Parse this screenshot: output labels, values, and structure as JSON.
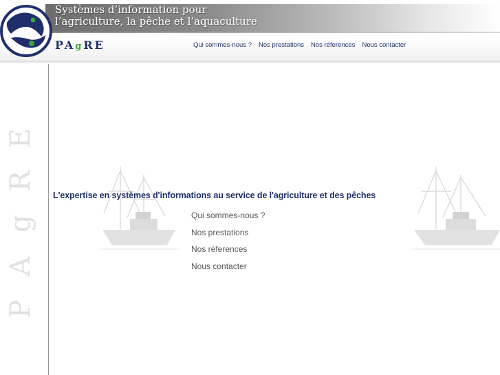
{
  "header": {
    "tagline": "Systèmes d’information pour\nl’agriculture, la pêche et l’aquaculture",
    "brand_prefix": "PA",
    "brand_g": "g",
    "brand_suffix": "RE"
  },
  "topnav": {
    "items": [
      "Qui sommes-nous ?",
      "Nos prestations",
      "Nos réferences",
      "Nous contacter"
    ]
  },
  "sidebar": {
    "letters": [
      "E",
      "R",
      "g",
      "A",
      "P"
    ]
  },
  "main": {
    "headline": "L'expertise en systèmes d'informations au service de l'agriculture et des pêches",
    "menu": [
      "Qui sommes-nous ?",
      "Nos prestations",
      "Nos réferences",
      "Nous contacter"
    ]
  },
  "colors": {
    "navy": "#1f2f6b",
    "green": "#3aa63a",
    "menu_gray": "#555555"
  }
}
